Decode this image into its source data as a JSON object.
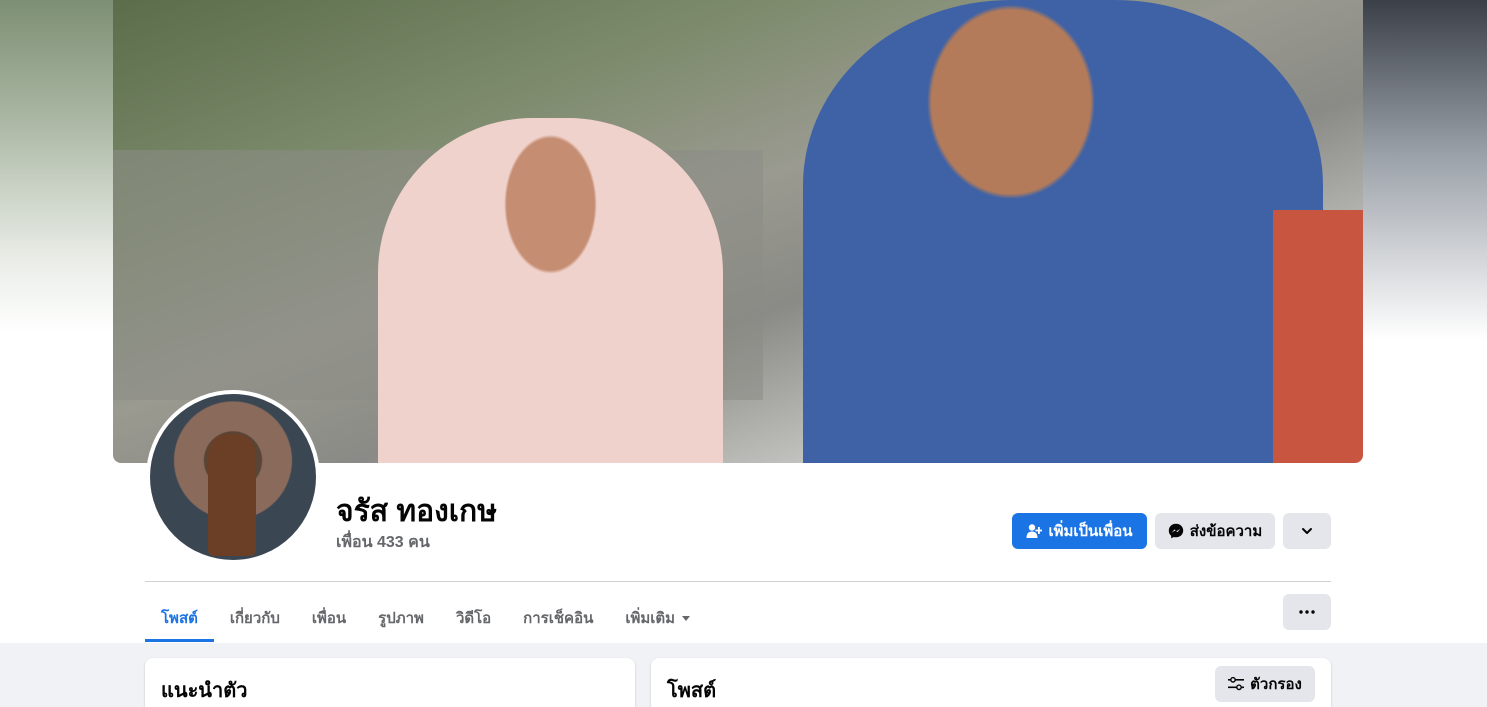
{
  "profile": {
    "name": "จรัส ทองเกษ",
    "friends_text": "เพื่อน 433 คน"
  },
  "actions": {
    "add_friend": "เพิ่มเป็นเพื่อน",
    "message": "ส่งข้อความ"
  },
  "tabs": [
    {
      "label": "โพสต์"
    },
    {
      "label": "เกี่ยวกับ"
    },
    {
      "label": "เพื่อน"
    },
    {
      "label": "รูปภาพ"
    },
    {
      "label": "วิดีโอ"
    },
    {
      "label": "การเช็คอิน"
    },
    {
      "label": "เพิ่มเติม"
    }
  ],
  "intro": {
    "title": "แนะนำตัว"
  },
  "posts": {
    "title": "โพสต์",
    "filter_label": "ตัวกรอง"
  },
  "colors": {
    "primary": "#1b74e4",
    "secondary_bg": "#e4e6eb",
    "page_bg": "#f0f2f5",
    "muted_text": "#65676b"
  },
  "icons": {
    "add_friend": "person-plus-icon",
    "message": "messenger-icon",
    "expand": "chevron-down-icon",
    "more_tab": "caret-down-icon",
    "options": "ellipsis-icon",
    "filter": "sliders-icon"
  }
}
